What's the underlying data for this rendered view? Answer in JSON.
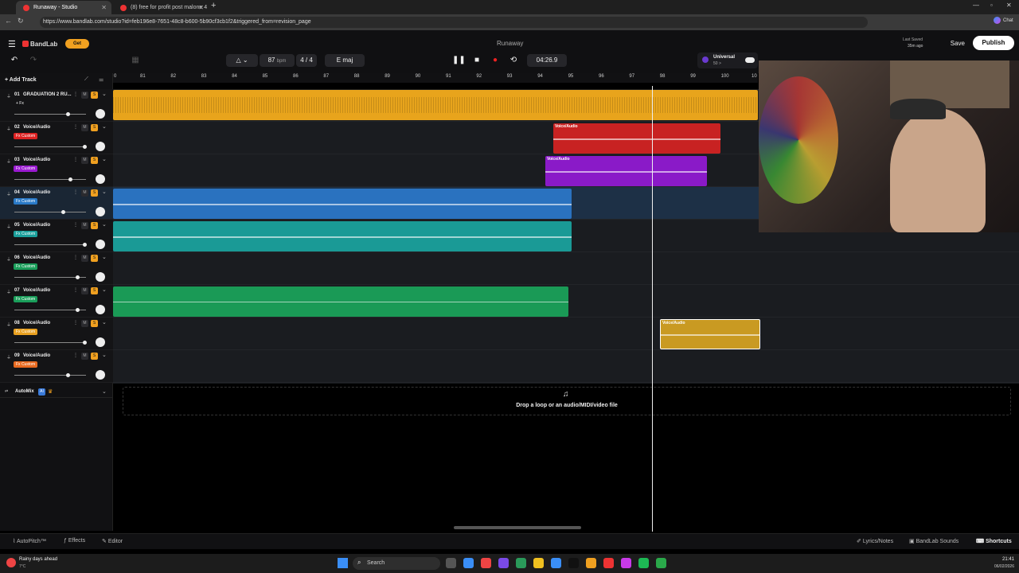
{
  "browser": {
    "tabs": [
      {
        "label": "Runaway - Studio",
        "active": true
      },
      {
        "label": "(8) free for profit post malone 4",
        "active": false
      }
    ],
    "url": "https://www.bandlab.com/studio?id=feb196e8-7651-48c8-b600-5b90cf3cb1f2&triggered_from=revision_page",
    "chat_label": "Chat"
  },
  "header": {
    "brand": "BandLab",
    "get_label": "Get",
    "project_title": "Runaway",
    "last_saved_label": "Last Saved",
    "last_saved_time": "35m ago",
    "save_label": "Save",
    "publish_label": "Publish",
    "bpm_value": "87",
    "bpm_unit": "bpm",
    "time_signature": "4 / 4",
    "key": "E maj",
    "time_display": "04:26.9",
    "universal_label": "Universal",
    "universal_sub": "50 >"
  },
  "tracks_panel": {
    "add_track_label": "Add Track",
    "tracks": [
      {
        "num": "01",
        "name": "GRADUATION 2 RU...",
        "fx": "+ Fx",
        "fx_color": "",
        "slider": 0.72
      },
      {
        "num": "02",
        "name": "Voice/Audio",
        "fx": "Fx Custom",
        "fx_color": "#d22",
        "slider": 0.96
      },
      {
        "num": "03",
        "name": "Voice/Audio",
        "fx": "Fx Custom",
        "fx_color": "#9a1ad0",
        "slider": 0.76
      },
      {
        "num": "04",
        "name": "Voice/Audio",
        "fx": "Fx Custom",
        "fx_color": "#2a7ac8",
        "slider": 0.66
      },
      {
        "num": "05",
        "name": "Voice/Audio",
        "fx": "Fx Custom",
        "fx_color": "#1a9e9a",
        "slider": 0.96
      },
      {
        "num": "06",
        "name": "Voice/Audio",
        "fx": "Fx Custom",
        "fx_color": "#1a9e5a",
        "slider": 0.86
      },
      {
        "num": "07",
        "name": "Voice/Audio",
        "fx": "Fx Custom",
        "fx_color": "#1a9e5a",
        "slider": 0.86
      },
      {
        "num": "08",
        "name": "Voice/Audio",
        "fx": "Fx Custom",
        "fx_color": "#e8a020",
        "slider": 0.96
      },
      {
        "num": "09",
        "name": "Voice/Audio",
        "fx": "Fx Custom",
        "fx_color": "#e86a20",
        "slider": 0.72
      }
    ],
    "automix_label": "AutoMix",
    "ai_badge": "AI"
  },
  "ruler": [
    "0",
    "81",
    "82",
    "83",
    "84",
    "85",
    "86",
    "87",
    "88",
    "89",
    "90",
    "91",
    "92",
    "93",
    "94",
    "95",
    "96",
    "97",
    "98",
    "99",
    "100",
    "10"
  ],
  "clip_label": "Voice/Audio",
  "drop_text": "Drop a loop or an audio/MIDI/video file",
  "bottom": {
    "autopitch": "AutoPitch™",
    "effects": "Effects",
    "editor": "Editor",
    "lyrics": "Lyrics/Notes",
    "sounds": "BandLab Sounds",
    "shortcuts": "Shortcuts"
  },
  "taskbar": {
    "weather_line1": "Rainy days ahead",
    "weather_line2": "7°C",
    "search_label": "Search",
    "time": "21:41",
    "date": "06/02/2026"
  }
}
